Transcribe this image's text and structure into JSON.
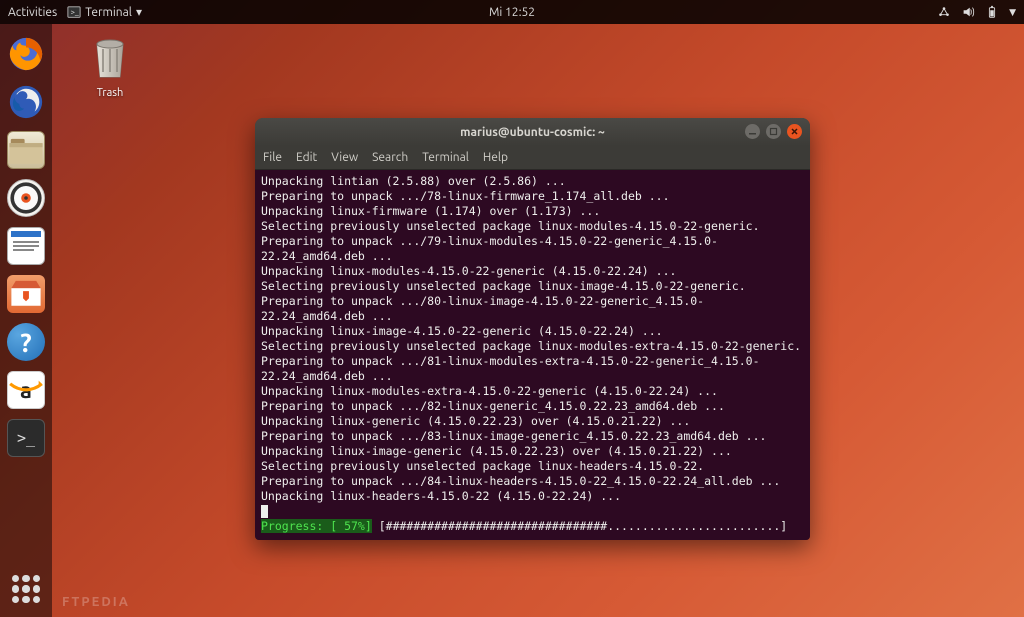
{
  "topbar": {
    "activities": "Activities",
    "app_label": "Terminal",
    "clock": "Mi 12:52"
  },
  "desktop": {
    "trash_label": "Trash"
  },
  "window": {
    "title": "marius@ubuntu-cosmic: ~",
    "menus": [
      "File",
      "Edit",
      "View",
      "Search",
      "Terminal",
      "Help"
    ]
  },
  "terminal": {
    "lines": [
      "Unpacking lintian (2.5.88) over (2.5.86) ...",
      "Preparing to unpack .../78-linux-firmware_1.174_all.deb ...",
      "Unpacking linux-firmware (1.174) over (1.173) ...",
      "Selecting previously unselected package linux-modules-4.15.0-22-generic.",
      "Preparing to unpack .../79-linux-modules-4.15.0-22-generic_4.15.0-22.24_amd64.deb ...",
      "Unpacking linux-modules-4.15.0-22-generic (4.15.0-22.24) ...",
      "Selecting previously unselected package linux-image-4.15.0-22-generic.",
      "Preparing to unpack .../80-linux-image-4.15.0-22-generic_4.15.0-22.24_amd64.deb ...",
      "Unpacking linux-image-4.15.0-22-generic (4.15.0-22.24) ...",
      "Selecting previously unselected package linux-modules-extra-4.15.0-22-generic.",
      "Preparing to unpack .../81-linux-modules-extra-4.15.0-22-generic_4.15.0-22.24_amd64.deb ...",
      "Unpacking linux-modules-extra-4.15.0-22-generic (4.15.0-22.24) ...",
      "Preparing to unpack .../82-linux-generic_4.15.0.22.23_amd64.deb ...",
      "Unpacking linux-generic (4.15.0.22.23) over (4.15.0.21.22) ...",
      "Preparing to unpack .../83-linux-image-generic_4.15.0.22.23_amd64.deb ...",
      "Unpacking linux-image-generic (4.15.0.22.23) over (4.15.0.21.22) ...",
      "Selecting previously unselected package linux-headers-4.15.0-22.",
      "Preparing to unpack .../84-linux-headers-4.15.0-22_4.15.0-22.24_all.deb ...",
      "Unpacking linux-headers-4.15.0-22 (4.15.0-22.24) ..."
    ],
    "progress_label": "Progress: [ 57%]",
    "progress_bar": "[################################.........................]"
  },
  "launcher": {
    "items": [
      {
        "name": "firefox-icon"
      },
      {
        "name": "thunderbird-icon"
      },
      {
        "name": "files-icon"
      },
      {
        "name": "rhythmbox-icon"
      },
      {
        "name": "writer-icon"
      },
      {
        "name": "software-icon"
      },
      {
        "name": "help-icon"
      },
      {
        "name": "amazon-icon"
      },
      {
        "name": "terminal-icon"
      }
    ]
  },
  "watermark": "FTPEDIA"
}
